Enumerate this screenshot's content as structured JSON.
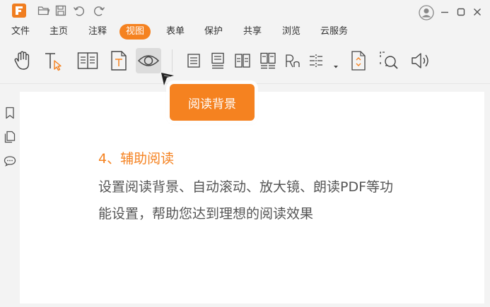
{
  "window": {
    "logo_icon": "foxit-logo-icon",
    "quick_access": [
      "open-folder-icon",
      "save-icon",
      "undo-icon",
      "redo-icon"
    ],
    "controls": [
      "user-avatar-icon",
      "minimize-icon",
      "maximize-icon",
      "close-icon"
    ]
  },
  "menu": {
    "items": [
      "文件",
      "主页",
      "注释",
      "视图",
      "表单",
      "保护",
      "共享",
      "浏览",
      "云服务"
    ],
    "active_index": 3
  },
  "toolbar": {
    "tools": [
      {
        "icon": "hand-tool-icon"
      },
      {
        "icon": "select-text-icon"
      },
      {
        "icon": "book-view-icon"
      },
      {
        "icon": "text-page-icon"
      },
      {
        "icon": "eye-icon",
        "selected": true
      },
      {
        "icon": "single-page-icon"
      },
      {
        "icon": "continuous-page-icon"
      },
      {
        "icon": "facing-pages-icon"
      },
      {
        "icon": "continuous-facing-icon"
      },
      {
        "icon": "reflow-icon"
      },
      {
        "icon": "split-view-icon",
        "dropdown": true
      },
      {
        "icon": "auto-scroll-icon"
      },
      {
        "icon": "magnifier-icon"
      },
      {
        "icon": "read-aloud-icon"
      }
    ]
  },
  "sidebar": {
    "icons": [
      "bookmark-icon",
      "pages-icon",
      "comment-icon"
    ]
  },
  "tooltip": {
    "label": "阅读背景"
  },
  "document": {
    "heading": "4、辅助阅读",
    "body": "设置阅读背景、自动滚动、放大镜、朗读PDF等功能设置，帮助您达到理想的阅读效果"
  },
  "colors": {
    "accent": "#f58220",
    "background": "#f3f3f3",
    "document": "#ffffff",
    "body_text": "#555555"
  }
}
